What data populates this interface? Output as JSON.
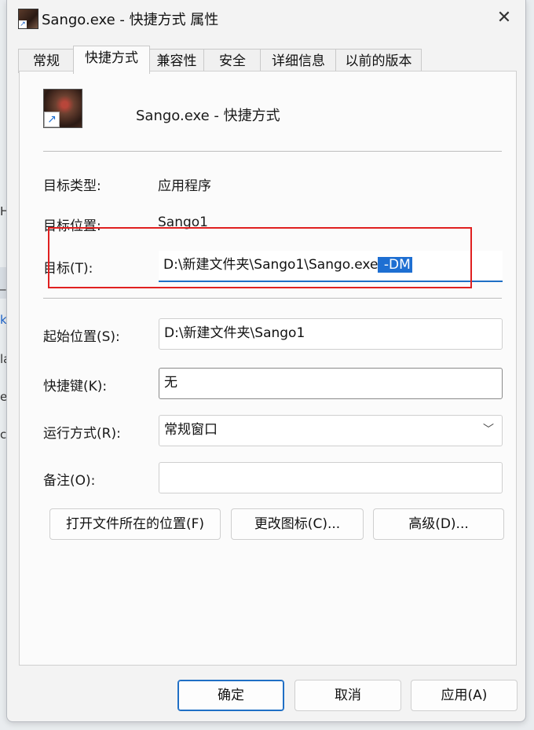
{
  "window": {
    "title": "Sango.exe - 快捷方式 属性"
  },
  "tabs": [
    "常规",
    "快捷方式",
    "兼容性",
    "安全",
    "详细信息",
    "以前的版本"
  ],
  "active_tab_index": 1,
  "shortcut": {
    "name": "Sango.exe - 快捷方式"
  },
  "fields": {
    "target_type": {
      "label": "目标类型:",
      "value": "应用程序"
    },
    "target_location": {
      "label": "目标位置:",
      "value": "Sango1"
    },
    "target": {
      "label": "目标(T):",
      "value": "D:\\新建文件夹\\Sango1\\Sango.exe",
      "selected_text": " -DM"
    },
    "start_in": {
      "label": "起始位置(S):",
      "value": "D:\\新建文件夹\\Sango1"
    },
    "shortcut_key": {
      "label": "快捷键(K):",
      "value": "无"
    },
    "run": {
      "label": "运行方式(R):",
      "value": "常规窗口"
    },
    "comment": {
      "label": "备注(O):",
      "value": ""
    }
  },
  "buttons": {
    "open_location": "打开文件所在的位置(F)",
    "change_icon": "更改图标(C)...",
    "advanced": "高级(D)...",
    "ok": "确定",
    "cancel": "取消",
    "apply": "应用(A)"
  },
  "background_fragments": [
    "H",
    "_",
    "k",
    "la",
    "ex",
    "co"
  ],
  "colors": {
    "accent": "#1f6fc5",
    "annotation_red": "#e02020"
  }
}
